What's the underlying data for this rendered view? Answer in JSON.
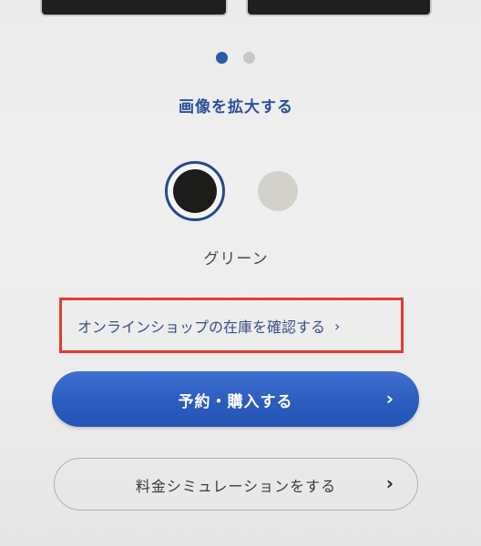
{
  "carousel": {
    "active_index": 0,
    "count": 2
  },
  "zoom_label": "画像を拡大する",
  "colors": {
    "selected_name": "グリーン",
    "swatches": [
      {
        "hex": "#1c1d1a",
        "selected": true
      },
      {
        "hex": "#d3d1cb",
        "selected": false
      }
    ]
  },
  "stock_link": {
    "label": "オンラインショップの在庫を確認する",
    "chevron": "›",
    "highlight_color": "#e23b2f"
  },
  "primary_button": {
    "label": "予約・購入する",
    "chevron": "›",
    "color": "#2b5cbf"
  },
  "secondary_button": {
    "label": "料金シミュレーションをする",
    "chevron": "›"
  },
  "icons": {
    "chevron": "chevron-right-icon"
  }
}
